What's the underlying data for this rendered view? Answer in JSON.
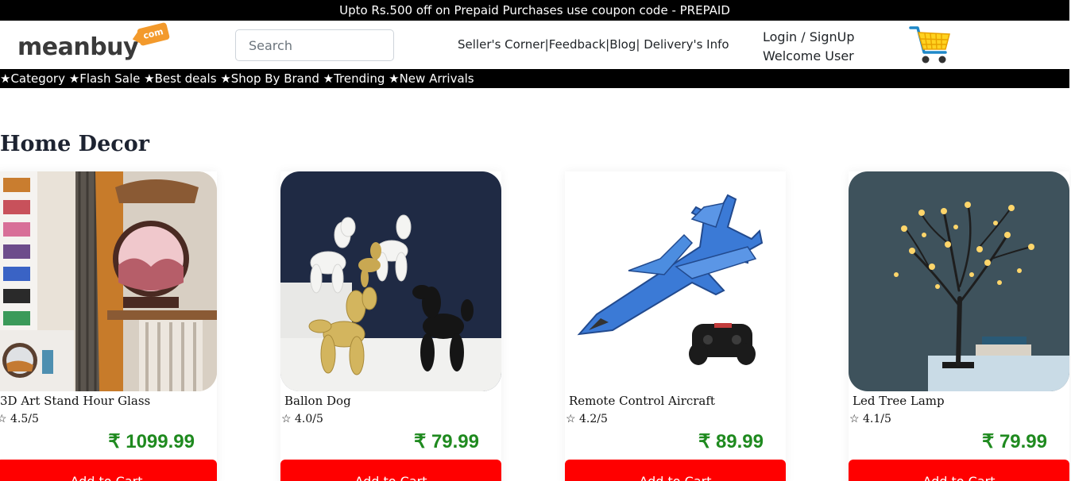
{
  "promo": {
    "text": "Upto Rs.500 off on Prepaid Purchases use coupon code - PREPAID"
  },
  "header": {
    "logo_text": "meanbuy",
    "logo_tag": "com",
    "search": {
      "placeholder": "Search",
      "value": ""
    },
    "links": [
      "Seller's Corner|",
      "Feedback|",
      "Blog|",
      "Delivery's Info"
    ],
    "login": "Login / SignUp",
    "welcome": "Welcome User",
    "cart_icon": "shopping-cart-icon"
  },
  "nav": {
    "items": [
      "★Category",
      "★Flash Sale",
      "★Best deals",
      "★Shop By Brand",
      "★Trending",
      "★New Arrivals"
    ]
  },
  "section": {
    "title": "Home Decor"
  },
  "products": [
    {
      "name": "3D Art Stand Hour Glass",
      "rating": "☆ 4.5/5",
      "price": "₹ 1099.99",
      "button": "Add to Cart"
    },
    {
      "name": "Ballon Dog",
      "rating": "☆ 4.0/5",
      "price": "₹ 79.99",
      "button": "Add to Cart"
    },
    {
      "name": "Remote Control Aircraft",
      "rating": "☆ 4.2/5",
      "price": "₹ 89.99",
      "button": "Add to Cart"
    },
    {
      "name": "Led Tree Lamp",
      "rating": "☆ 4.1/5",
      "price": "₹ 79.99",
      "button": "Add to Cart"
    }
  ],
  "colors": {
    "price": "#1f8a1f",
    "button": "#ff0000",
    "bars": "#000000",
    "logo_tag": "#f39a2c"
  }
}
